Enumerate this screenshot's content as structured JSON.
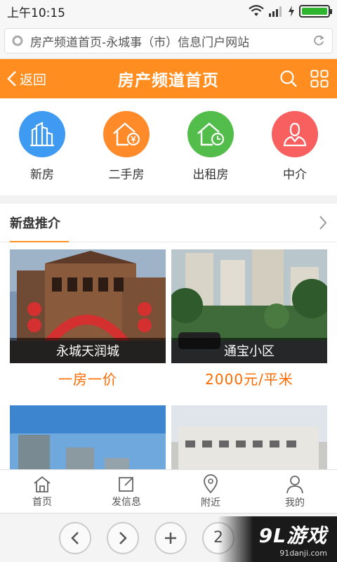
{
  "status_bar": {
    "time": "上午10:15"
  },
  "browser": {
    "url": "房产频道首页-永城事（市）信息门户网站",
    "tab_count": "2"
  },
  "header": {
    "back_label": "返回",
    "title": "房产频道首页"
  },
  "categories": [
    {
      "label": "新房",
      "color": "#3f9af2",
      "icon": "buildings-icon"
    },
    {
      "label": "二手房",
      "color": "#ff8a2a",
      "icon": "house-yen-icon"
    },
    {
      "label": "出租房",
      "color": "#52bd4a",
      "icon": "house-clock-icon"
    },
    {
      "label": "中介",
      "color": "#f85f5f",
      "icon": "agent-icon"
    }
  ],
  "section": {
    "title": "新盘推介",
    "cards": [
      {
        "name": "永城天润城",
        "price": "一房一价"
      },
      {
        "name": "通宝小区",
        "price": "2000元/平米"
      },
      {
        "name": "",
        "price": ""
      },
      {
        "name": "",
        "price": ""
      }
    ]
  },
  "tabbar": [
    {
      "label": "首页",
      "icon": "home-icon"
    },
    {
      "label": "发信息",
      "icon": "edit-icon"
    },
    {
      "label": "附近",
      "icon": "location-icon"
    },
    {
      "label": "我的",
      "icon": "user-icon"
    }
  ],
  "watermark": {
    "main": "9L游戏",
    "sub": "91danji.com"
  },
  "colors": {
    "accent": "#ff8d1f",
    "price": "#ff6a00"
  }
}
